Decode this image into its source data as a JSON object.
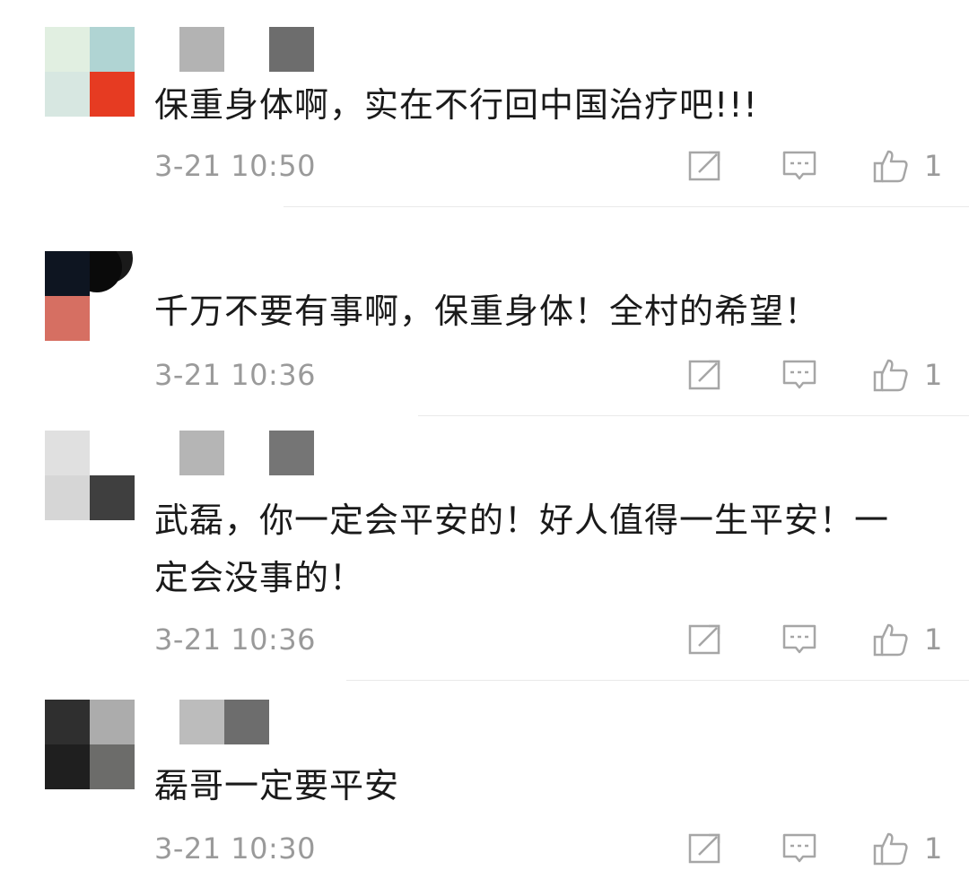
{
  "comments": [
    {
      "text": "保重身体啊，实在不行回中国治疗吧!!!",
      "time": "3-21 10:50",
      "likes": "1",
      "avatar_colors": [
        "#e1efe1",
        "#b0d4d3",
        "#d7e7e1",
        "#e63b22"
      ],
      "name_colors": [
        "#b3b3b3",
        "#ffffff",
        "#6d6d6d"
      ]
    },
    {
      "text": "千万不要有事啊，保重身体！全村的希望！",
      "time": "3-21 10:36",
      "likes": "1",
      "avatar_colors": [
        "#0e1521",
        "#1a1a1a",
        "#d66f62",
        "#ffffff"
      ],
      "name_colors": [
        "#ffffff",
        "#ffffff",
        "#ffffff"
      ]
    },
    {
      "text_lines": [
        "武磊，你一定会平安的！好人值得一生平安！一",
        "定会没事的！"
      ],
      "time": "3-21 10:36",
      "likes": "1",
      "avatar_colors": [
        "#e0e0e0",
        "#ffffff",
        "#d6d6d6",
        "#3f3f3f"
      ],
      "name_colors": [
        "#ffffff",
        "#b5b5b5",
        "#ffffff",
        "#757575"
      ]
    },
    {
      "text": "磊哥一定要平安",
      "time": "3-21 10:30",
      "likes": "1",
      "avatar_colors": [
        "#2f2f2f",
        "#acacac",
        "#1f1f1f",
        "#6c6c6a"
      ],
      "name_colors": [
        "#bcbcbc",
        "#6d6d6d"
      ]
    }
  ],
  "icons": {
    "share": "share-icon",
    "reply": "reply-icon",
    "like": "thumbs-up-icon"
  }
}
